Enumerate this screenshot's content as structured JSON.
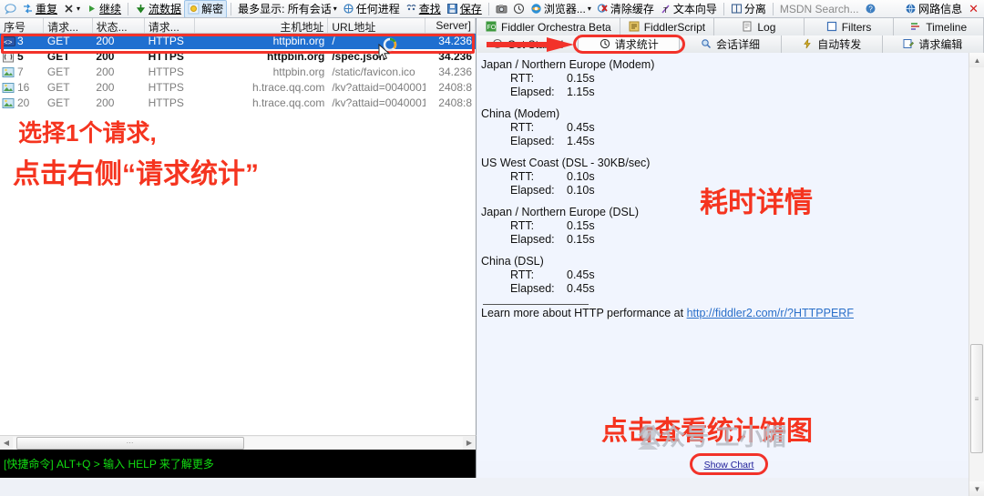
{
  "toolbar": {
    "items": [
      {
        "icon": "comment-bubble-icon",
        "label": ""
      },
      {
        "icon": "replay-icon",
        "label": "重复"
      },
      {
        "icon": "remove-x-icon",
        "label": ""
      },
      {
        "icon": "play-icon",
        "label": "继续"
      },
      {
        "icon": "stream-arrow-icon",
        "label": "流数据"
      },
      {
        "icon": "decrypt-icon",
        "label": "解密"
      },
      {
        "icon": "",
        "label": "最多显示: 所有会话"
      },
      {
        "icon": "process-icon",
        "label": "任何进程"
      },
      {
        "icon": "find-icon",
        "label": "查找"
      },
      {
        "icon": "save-icon",
        "label": "保存"
      },
      {
        "icon": "camera-icon",
        "label": ""
      },
      {
        "icon": "clock-icon",
        "label": ""
      },
      {
        "icon": "browser-icon",
        "label": "浏览器..."
      },
      {
        "icon": "clear-cache-icon",
        "label": "清除缓存"
      },
      {
        "icon": "textwizard-icon",
        "label": "文本向导"
      },
      {
        "icon": "detach-icon",
        "label": "分离"
      },
      {
        "icon": "",
        "label": "MSDN Search..."
      },
      {
        "icon": "help-icon",
        "label": ""
      },
      {
        "icon": "network-info-icon",
        "label": "网路信息"
      },
      {
        "icon": "close-icon",
        "label": "✕"
      }
    ],
    "dropdown_caret": "▾"
  },
  "grid": {
    "columns": [
      {
        "key": "id",
        "label": "序号",
        "align": "left"
      },
      {
        "key": "method",
        "label": "请求...",
        "align": "left"
      },
      {
        "key": "status",
        "label": "状态...",
        "align": "left"
      },
      {
        "key": "protocol",
        "label": "请求...",
        "align": "left"
      },
      {
        "key": "host",
        "label": "主机地址",
        "align": "right"
      },
      {
        "key": "url",
        "label": "URL地址",
        "align": "left"
      },
      {
        "key": "server",
        "label": "Server]",
        "align": "right"
      }
    ],
    "rows": [
      {
        "id": "3",
        "method": "GET",
        "status": "200",
        "protocol": "HTTPS",
        "host": "httpbin.org",
        "url": "/",
        "server": "34.236",
        "icon": "code-brackets-icon",
        "state": "selected"
      },
      {
        "id": "5",
        "method": "GET",
        "status": "200",
        "protocol": "HTTPS",
        "host": "httpbin.org",
        "url": "/spec.json",
        "server": "34.236",
        "icon": "json-doc-icon",
        "state": "bold"
      },
      {
        "id": "7",
        "method": "GET",
        "status": "200",
        "protocol": "HTTPS",
        "host": "httpbin.org",
        "url": "/static/favicon.ico",
        "server": "34.236",
        "icon": "image-icon",
        "state": "dim"
      },
      {
        "id": "16",
        "method": "GET",
        "status": "200",
        "protocol": "HTTPS",
        "host": "h.trace.qq.com",
        "url": "/kv?attaid=0040001...",
        "server": "2408:8",
        "icon": "image-icon",
        "state": "dim"
      },
      {
        "id": "20",
        "method": "GET",
        "status": "200",
        "protocol": "HTTPS",
        "host": "h.trace.qq.com",
        "url": "/kv?attaid=0040001...",
        "server": "2408:8",
        "icon": "image-icon",
        "state": "dim"
      }
    ]
  },
  "quickexec": {
    "text": "[快捷命令] ALT+Q > 输入 HELP 来了解更多"
  },
  "inspector": {
    "tabs_top": [
      {
        "label": "Fiddler Orchestra Beta",
        "icon": "orchestra-icon",
        "active": false
      },
      {
        "label": "FiddlerScript",
        "icon": "script-icon",
        "active": false
      },
      {
        "label": "Log",
        "icon": "log-icon",
        "active": false
      },
      {
        "label": "Filters",
        "icon": "filter-icon",
        "active": false
      },
      {
        "label": "Timeline",
        "icon": "timeline-icon",
        "active": false
      }
    ],
    "tabs_bottom": [
      {
        "label": "Get Started",
        "icon": "getstarted-icon",
        "active": false
      },
      {
        "label": "请求统计",
        "icon": "statistics-icon",
        "active": true
      },
      {
        "label": "会话详细",
        "icon": "inspector-icon",
        "active": false
      },
      {
        "label": "自动转发",
        "icon": "autoresponder-icon",
        "active": false
      },
      {
        "label": "请求编辑",
        "icon": "composer-icon",
        "active": false
      }
    ]
  },
  "statistics": {
    "groups": [
      {
        "title": "Japan / Northern Europe (Modem)",
        "rtt_label": "RTT:",
        "rtt": "0.15s",
        "elapsed_label": "Elapsed:",
        "elapsed": "1.15s"
      },
      {
        "title": "China (Modem)",
        "rtt_label": "RTT:",
        "rtt": "0.45s",
        "elapsed_label": "Elapsed:",
        "elapsed": "1.45s"
      },
      {
        "title": "US West Coast (DSL - 30KB/sec)",
        "rtt_label": "RTT:",
        "rtt": "0.10s",
        "elapsed_label": "Elapsed:",
        "elapsed": "0.10s"
      },
      {
        "title": "Japan / Northern Europe (DSL)",
        "rtt_label": "RTT:",
        "rtt": "0.15s",
        "elapsed_label": "Elapsed:",
        "elapsed": "0.15s"
      },
      {
        "title": "China (DSL)",
        "rtt_label": "RTT:",
        "rtt": "0.45s",
        "elapsed_label": "Elapsed:",
        "elapsed": "0.45s"
      }
    ],
    "learn_prefix": "Learn more about HTTP performance at ",
    "learn_link": "http://fiddler2.com/r/?HTTPPERF",
    "show_chart_label": "Show Chart"
  },
  "annotations": {
    "left_line1": "选择1个请求,",
    "left_line2": "点击右侧“请求统计”",
    "right_label": "耗时详情",
    "bottom_label": "点击查看统计饼图",
    "watermark": "公众号 工小帽"
  },
  "colors": {
    "annotation_red": "#f5341f",
    "selection_blue": "#1f6fd0",
    "panel_blue": "#f0f4fd",
    "quickexec_green": "#12dd12",
    "link_blue": "#2a6fc9"
  }
}
